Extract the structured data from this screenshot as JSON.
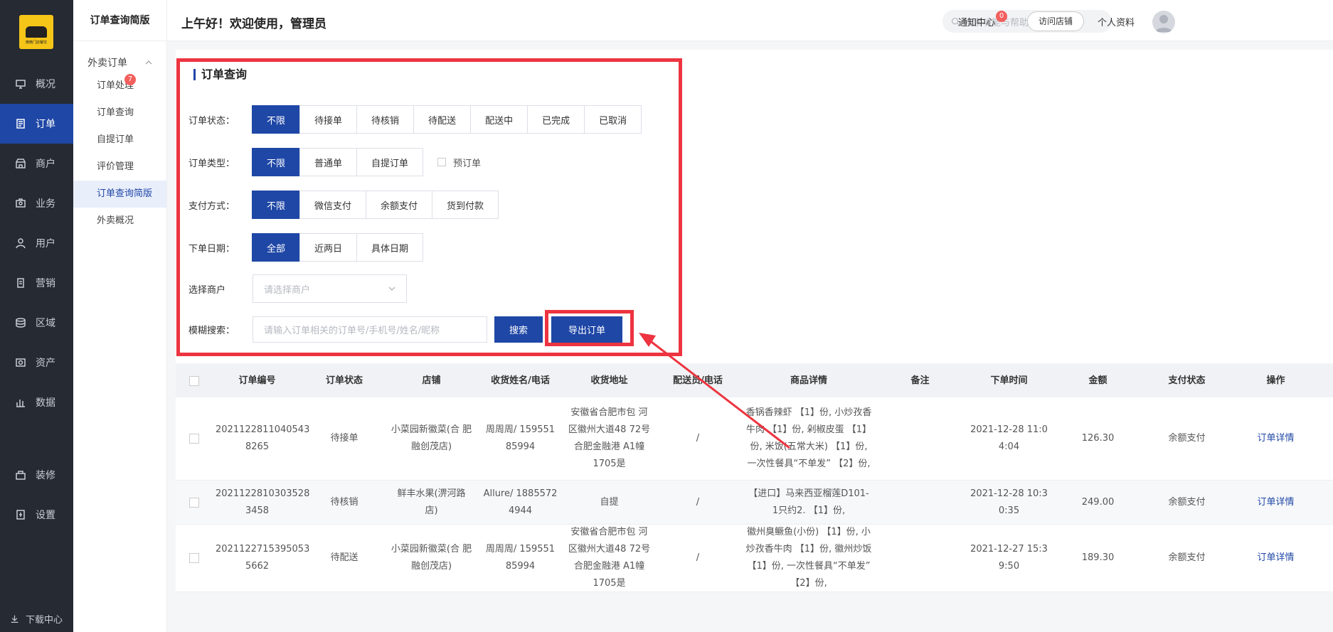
{
  "sidebar": {
    "logo_text": "微微门店餐饮",
    "items": [
      {
        "label": "概况",
        "icon": "dashboard-icon"
      },
      {
        "label": "订单",
        "icon": "order-icon",
        "active": true
      },
      {
        "label": "商户",
        "icon": "shop-icon"
      },
      {
        "label": "业务",
        "icon": "business-icon"
      },
      {
        "label": "用户",
        "icon": "user-icon"
      },
      {
        "label": "营销",
        "icon": "marketing-icon"
      },
      {
        "label": "区域",
        "icon": "region-icon"
      },
      {
        "label": "资产",
        "icon": "asset-icon"
      },
      {
        "label": "数据",
        "icon": "data-icon"
      }
    ],
    "bottom_items": [
      {
        "label": "装修",
        "icon": "decorate-icon"
      },
      {
        "label": "设置",
        "icon": "settings-icon"
      }
    ],
    "download_label": "下载中心"
  },
  "subbar": {
    "title": "订单查询简版",
    "group_label": "外卖订单",
    "items": [
      {
        "label": "订单处理",
        "badge": "7"
      },
      {
        "label": "订单查询"
      },
      {
        "label": "自提订单"
      },
      {
        "label": "评价管理"
      },
      {
        "label": "订单查询简版",
        "active": true
      },
      {
        "label": "外卖概况"
      }
    ]
  },
  "header": {
    "greeting": "上午好！欢迎使用，管理员",
    "search_placeholder": "搜索功能与帮助",
    "notice_label": "通知中心",
    "notice_count": "0",
    "visit_label": "访问店铺",
    "profile_label": "个人资料"
  },
  "filters": {
    "title": "订单查询",
    "status": {
      "label": "订单状态：",
      "options": [
        "不限",
        "待接单",
        "待核销",
        "待配送",
        "配送中",
        "已完成",
        "已取消"
      ]
    },
    "type": {
      "label": "订单类型：",
      "options": [
        "不限",
        "普通单",
        "自提订单"
      ],
      "checkbox": "预订单"
    },
    "pay": {
      "label": "支付方式：",
      "options": [
        "不限",
        "微信支付",
        "余额支付",
        "货到付款"
      ]
    },
    "date": {
      "label": "下单日期：",
      "options": [
        "全部",
        "近两日",
        "具体日期"
      ]
    },
    "merchant": {
      "label": "选择商户",
      "placeholder": "请选择商户"
    },
    "keyword": {
      "label": "模糊搜索：",
      "placeholder": "请输入订单相关的订单号/手机号/姓名/昵称"
    },
    "search_btn": "搜索",
    "export_btn": "导出订单"
  },
  "table": {
    "headers": [
      "订单编号",
      "订单状态",
      "店铺",
      "收货姓名/电话",
      "收货地址",
      "配送员/电话",
      "商品详情",
      "备注",
      "下单时间",
      "金额",
      "支付状态",
      "操作"
    ],
    "rows": [
      {
        "order_no": "2021122811040543 8265",
        "status": "待接单",
        "shop": "小菜园新徽菜(合 肥融创茂店)",
        "receiver": "周周周/ 159551 85994",
        "address": "安徽省合肥市包 河区徽州大道48 72号合肥金融港 A1幢1705是",
        "courier": "/",
        "goods": "香锅香辣虾 【1】份, 小炒孜香牛肉 【1】份, 剁椒皮蛋 【1】份, 米饭(五常大米) 【1】份, 一次性餐具“不单发” 【2】份,",
        "remark": "",
        "time": "2021-12-28 11:0 4:04",
        "amount": "126.30",
        "pay_status": "余额支付",
        "action": "订单详情"
      },
      {
        "order_no": "2021122810303528 3458",
        "status": "待核销",
        "shop": "鲜丰水果(淠河路 店)",
        "receiver": "Allure/ 1885572 4944",
        "address": "自提",
        "courier": "/",
        "goods": "【进口】马来西亚榴莲D101- 1只约2. 【1】份,",
        "remark": "",
        "time": "2021-12-28 10:3 0:35",
        "amount": "249.00",
        "pay_status": "余额支付",
        "action": "订单详情"
      },
      {
        "order_no": "2021122715395053 5662",
        "status": "待配送",
        "shop": "小菜园新徽菜(合 肥融创茂店)",
        "receiver": "周周周/ 159551 85994",
        "address": "安徽省合肥市包 河区徽州大道48 72号合肥金融港 A1幢1705是",
        "courier": "/",
        "goods": "徽州臭鳜鱼(小份) 【1】份, 小炒孜香牛肉 【1】份, 徽州炒饭 【1】份, 一次性餐具“不单发” 【2】份,",
        "remark": "",
        "time": "2021-12-27 15:3 9:50",
        "amount": "189.30",
        "pay_status": "余额支付",
        "action": "订单详情"
      }
    ]
  },
  "colors": {
    "primary": "#1f47a6",
    "sidebar_bg": "#262a33",
    "annotation": "#ed3440"
  }
}
